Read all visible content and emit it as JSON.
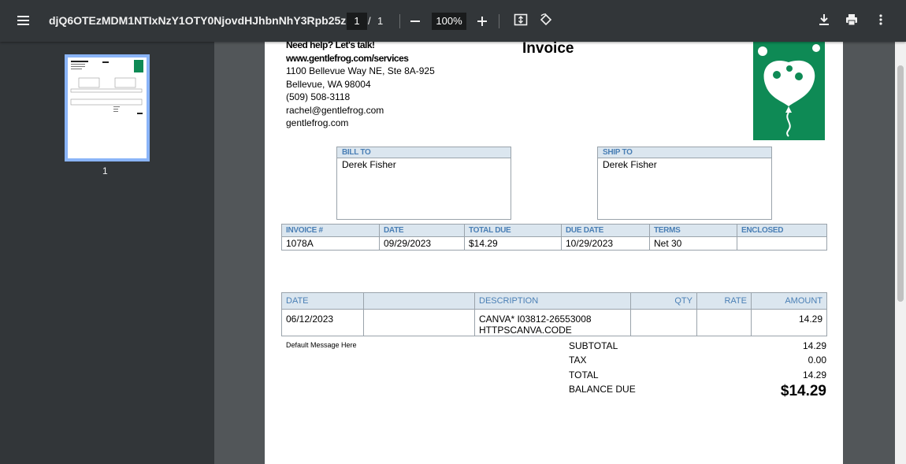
{
  "toolbar": {
    "title": "djQ6OTEzMDM1NTIxNzY1OTY0NjovdHJhbnNhY3Rpb25zL...",
    "current_page": "1",
    "page_separator": "/",
    "total_pages": "1",
    "zoom": "100%",
    "icons": [
      "menu-icon",
      "zoom-out-icon",
      "zoom-in-icon",
      "fit-page-icon",
      "rotate-icon",
      "download-icon",
      "print-icon",
      "more-icon"
    ]
  },
  "sidebar": {
    "thumbnail_page": "1"
  },
  "invoice": {
    "company": {
      "line1": "Need help? Let's talk!",
      "line2": "www.gentlefrog.com/services",
      "address1": "1100 Bellevue Way NE, Ste 8A-925",
      "address2": "Bellevue, WA  98004",
      "phone": "(509) 508-3118",
      "email": "rachel@gentlefrog.com",
      "website": "gentlefrog.com"
    },
    "title": "Invoice",
    "bill_to": {
      "label": "BILL TO",
      "name": "Derek Fisher"
    },
    "ship_to": {
      "label": "SHIP TO",
      "name": "Derek Fisher"
    },
    "summary": {
      "headers": [
        "INVOICE #",
        "DATE",
        "TOTAL DUE",
        "DUE DATE",
        "TERMS",
        "ENCLOSED"
      ],
      "values": [
        "1078A",
        "09/29/2023",
        "$14.29",
        "10/29/2023",
        "Net 30",
        ""
      ]
    },
    "lines": {
      "headers": [
        "DATE",
        "",
        "DESCRIPTION",
        "QTY",
        "RATE",
        "AMOUNT"
      ],
      "rows": [
        {
          "date": "06/12/2023",
          "blank": "",
          "description1": "CANVA* I03812-26553008",
          "description2": "HTTPSCANVA.CODE",
          "qty": "",
          "rate": "",
          "amount": "14.29"
        }
      ]
    },
    "message": "Default Message Here",
    "totals": {
      "subtotal_label": "SUBTOTAL",
      "subtotal": "14.29",
      "tax_label": "TAX",
      "tax": "0.00",
      "total_label": "TOTAL",
      "total": "14.29",
      "balance_label": "BALANCE DUE",
      "balance": "$14.29"
    },
    "colors": {
      "logo_green": "#0e8a55",
      "header_blue": "#4a7fb5",
      "header_bg": "#dbe6ef"
    }
  }
}
